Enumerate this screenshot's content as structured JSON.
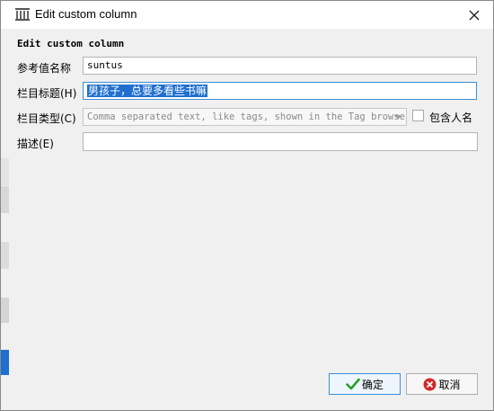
{
  "window": {
    "title": "Edit custom column",
    "app_icon": "calibre-library-icon",
    "close_icon": "close-icon"
  },
  "form": {
    "heading": "Edit custom column",
    "lookup_name": {
      "label": "参考值名称",
      "value": "suntus"
    },
    "column_heading": {
      "label": "栏目标题(H)",
      "value": "男孩子，总要多看些书嘛",
      "selected": true
    },
    "column_type": {
      "label": "栏目类型(C)",
      "value": "Comma separated text, like tags, shown in the Tag browser",
      "disabled": true
    },
    "contains_names": {
      "label": "包含人名",
      "checked": false
    },
    "description": {
      "label": "描述(E)",
      "value": ""
    }
  },
  "buttons": {
    "ok_label": "确定",
    "cancel_label": "取消"
  },
  "colors": {
    "accent": "#1f6fd0",
    "ok_check": "#2a9d2a",
    "cancel_icon": "#d12a2a"
  }
}
